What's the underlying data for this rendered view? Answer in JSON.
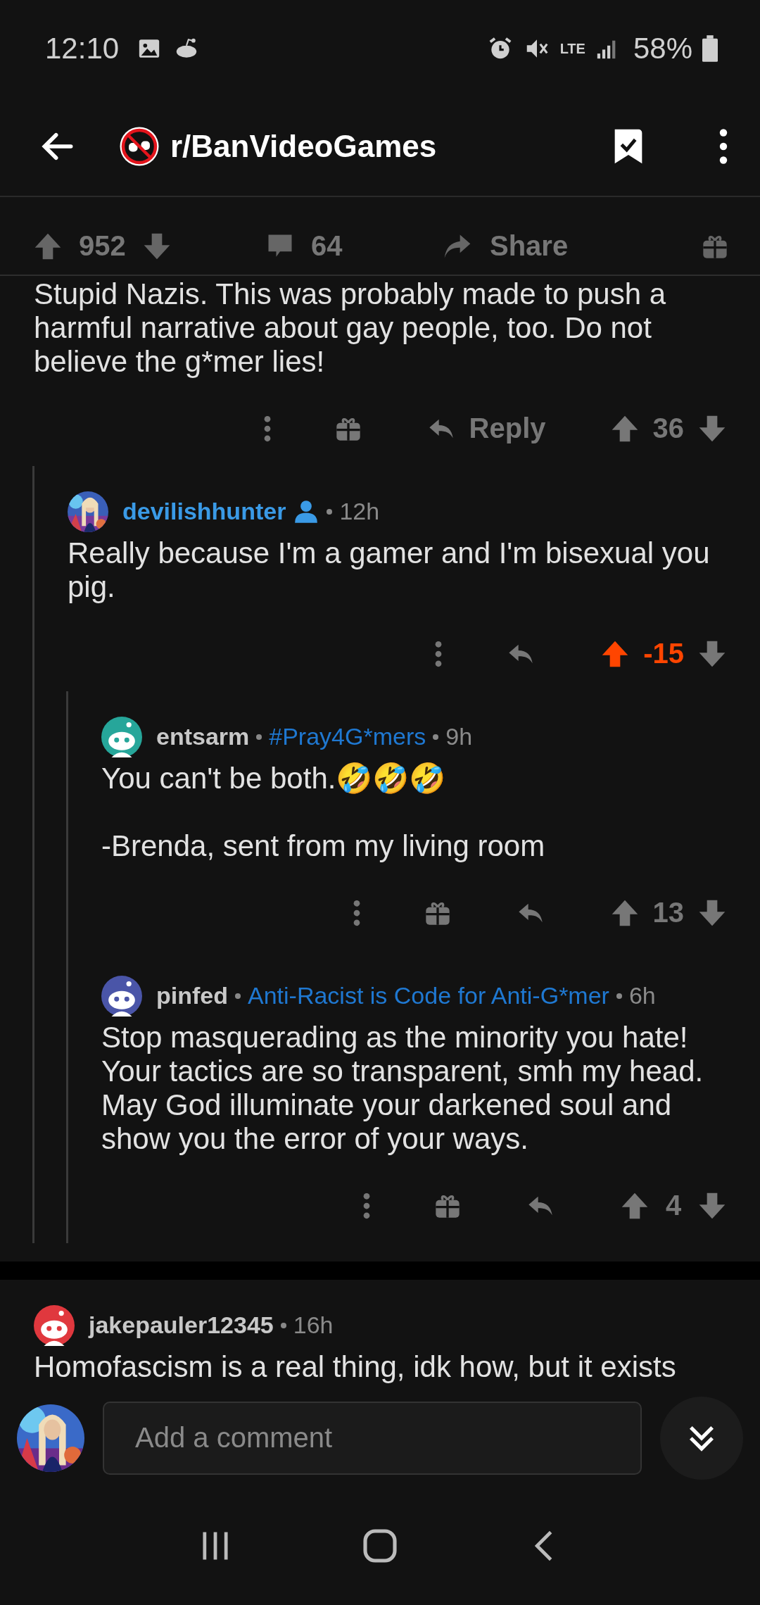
{
  "status_bar": {
    "time": "12:10",
    "network": "LTE",
    "battery": "58%"
  },
  "header": {
    "title": "r/BanVideoGames"
  },
  "post_bar": {
    "votes": "952",
    "comments": "64",
    "share": "Share"
  },
  "comments": [
    {
      "paragraphs": [
        "Stupid Nazis. This was probably made to push a harmful narrative about gay people, too. Do not believe the g*mer lies!"
      ],
      "actions": {
        "award": true,
        "reply_label": "Reply",
        "score": "36",
        "upvoted": false
      },
      "children": [
        {
          "author": "devilishhunter",
          "is_op": true,
          "avatar": {
            "kind": "picture"
          },
          "time": "12h",
          "paragraphs": [
            "Really because I'm a gamer and I'm bisexual you pig."
          ],
          "actions": {
            "award": false,
            "score": "-15",
            "upvoted": true
          },
          "children": [
            {
              "author": "entsarm",
              "is_op": false,
              "avatar": {
                "kind": "snoo",
                "color": "#26a69a"
              },
              "flair": "#Pray4G*mers",
              "time": "9h",
              "paragraphs": [
                "You can't be both.🤣🤣🤣",
                "-Brenda, sent from my living room"
              ],
              "actions": {
                "award": true,
                "score": "13",
                "upvoted": false
              }
            },
            {
              "author": "pinfed",
              "is_op": false,
              "avatar": {
                "kind": "snoo",
                "color": "#4a55a8"
              },
              "flair": "Anti-Racist is Code for Anti-G*mer",
              "time": "6h",
              "paragraphs": [
                "Stop masquerading as the minority you hate! Your tactics are so transparent, smh my head. May God illuminate your darkened soul and show you the error of your ways."
              ],
              "actions": {
                "award": true,
                "score": "4",
                "upvoted": false
              }
            }
          ]
        }
      ]
    },
    {
      "author": "jakepauler12345",
      "is_op": false,
      "avatar": {
        "kind": "snoo",
        "color": "#e0383e"
      },
      "time": "16h",
      "paragraphs": [
        "Homofascism is a real thing, idk how, but it exists"
      ]
    }
  ],
  "composer": {
    "placeholder": "Add a comment"
  }
}
